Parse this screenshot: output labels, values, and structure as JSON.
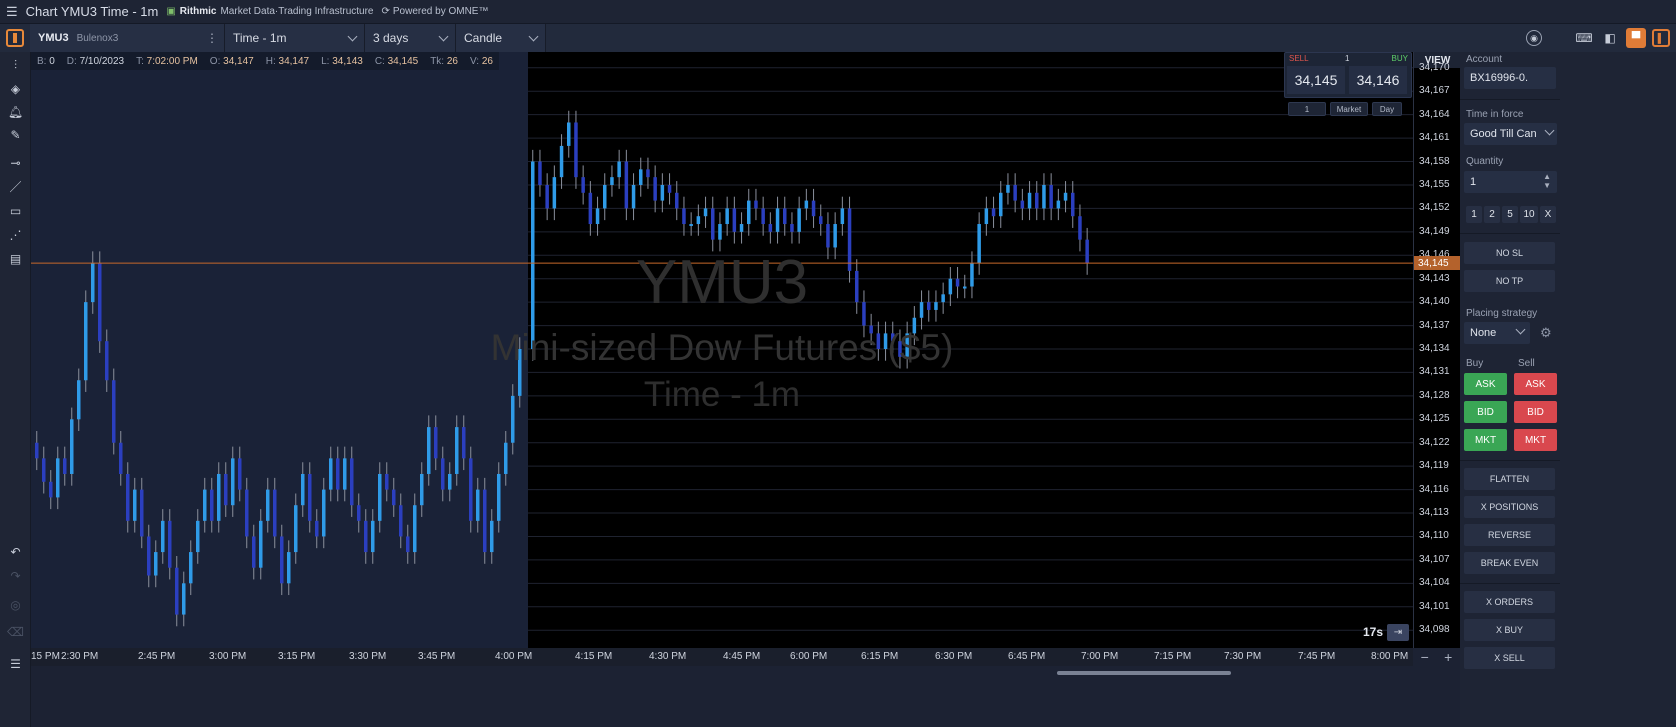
{
  "window": {
    "title": "Chart YMU3 Time - 1m",
    "brand_name": "Rithmic",
    "brand_tagline": "Market Data·Trading Infrastructure",
    "powered_by": "Powered by OMNE™"
  },
  "toolbar": {
    "symbol": "YMU3",
    "account_short": "Bulenox3",
    "interval": "Time - 1m",
    "range": "3 days",
    "chart_type": "Candle"
  },
  "ohlc": {
    "b_label": "B:",
    "b": "0",
    "d_label": "D:",
    "d": "7/10/2023",
    "t_label": "T:",
    "t": "7:02:00 PM",
    "o_label": "O:",
    "o": "34,147",
    "h_label": "H:",
    "h": "34,147",
    "l_label": "L:",
    "l": "34,143",
    "c_label": "C:",
    "c": "34,145",
    "tk_label": "Tk:",
    "tk": "26",
    "v_label": "V:",
    "v": "26"
  },
  "watermark": {
    "symbol": "YMU3",
    "name": "Mini-sized Dow Futures ($5)",
    "interval": "Time - 1m"
  },
  "chart_trader": {
    "sell_label": "SELL",
    "qty": "1",
    "buy_label": "BUY",
    "bid": "34,145",
    "ask": "34,146",
    "chip_qty": "1",
    "chip_type": "Market",
    "chip_tif": "Day"
  },
  "timer": "17s",
  "view_label": "VIEW",
  "last_price_label": "34,145",
  "colors": {
    "candle_up": "#2f9be8",
    "candle_down": "#2b3fbf",
    "last_price_line": "#c8692b",
    "buy": "#3aa655",
    "sell": "#d9484e"
  },
  "panel": {
    "account_label": "Account",
    "account_value": "BX16996-0.",
    "tif_label": "Time in force",
    "tif_value": "Good Till Can",
    "quantity_label": "Quantity",
    "quantity_value": "1",
    "quick_qty": [
      "1",
      "2",
      "5",
      "10",
      "X"
    ],
    "no_sl": "NO SL",
    "no_tp": "NO TP",
    "strategy_label": "Placing strategy",
    "strategy_value": "None",
    "buy_label": "Buy",
    "sell_label": "Sell",
    "buy_ask": "ASK",
    "sell_ask": "ASK",
    "buy_bid": "BID",
    "sell_bid": "BID",
    "buy_mkt": "MKT",
    "sell_mkt": "MKT",
    "flatten": "FLATTEN",
    "x_positions": "X POSITIONS",
    "reverse": "REVERSE",
    "break_even": "BREAK EVEN",
    "x_orders": "X ORDERS",
    "x_buy": "X BUY",
    "x_sell": "X SELL"
  },
  "chart_data": {
    "type": "candlestick",
    "y_ticks": [
      "34,170",
      "34,167",
      "34,164",
      "34,161",
      "34,158",
      "34,155",
      "34,152",
      "34,149",
      "34,146",
      "34,143",
      "34,140",
      "34,137",
      "34,134",
      "34,131",
      "34,128",
      "34,125",
      "34,122",
      "34,119",
      "34,116",
      "34,113",
      "34,110",
      "34,107",
      "34,104",
      "34,101",
      "34,098"
    ],
    "ylim": [
      34097,
      34171
    ],
    "x_ticks": [
      "2:15 PM",
      "2:30 PM",
      "2:45 PM",
      "3:00 PM",
      "3:15 PM",
      "3:30 PM",
      "3:45 PM",
      "4:00 PM",
      "4:15 PM",
      "4:30 PM",
      "4:45 PM",
      "6:00 PM",
      "6:15 PM",
      "6:30 PM",
      "6:45 PM",
      "7:00 PM",
      "7:15 PM",
      "7:30 PM",
      "7:45 PM",
      "8:00 PM"
    ],
    "x_tick_labels_shown": [
      "15 PM",
      "2:30 PM",
      "2:45 PM",
      "3:00 PM",
      "3:15 PM",
      "3:30 PM",
      "3:45 PM",
      "4:00 PM",
      "4:15 PM",
      "4:30 PM",
      "4:45 PM",
      "6:00 PM",
      "6:15 PM",
      "6:30 PM",
      "6:45 PM",
      "7:00 PM",
      "7:15 PM",
      "7:30 PM",
      "7:45 PM",
      "8:00 PM"
    ],
    "last_price": 34145,
    "closes": [
      34120,
      34117,
      34115,
      34120,
      34118,
      34125,
      34130,
      34140,
      34145,
      34135,
      34130,
      34122,
      34118,
      34112,
      34116,
      34110,
      34105,
      34108,
      34112,
      34106,
      34100,
      34104,
      34108,
      34112,
      34116,
      34112,
      34118,
      34114,
      34120,
      34116,
      34110,
      34106,
      34112,
      34116,
      34110,
      34104,
      34108,
      34114,
      34118,
      34112,
      34110,
      34116,
      34120,
      34116,
      34120,
      34114,
      34112,
      34108,
      34112,
      34118,
      34116,
      34114,
      34110,
      34108,
      34114,
      34118,
      34124,
      34120,
      34116,
      34118,
      34124,
      34120,
      34112,
      34116,
      34108,
      34112,
      34118,
      34122,
      34128,
      34134,
      34158,
      34155,
      34152,
      34156,
      34160,
      34163,
      34156,
      34154,
      34150,
      34152,
      34155,
      34156,
      34158,
      34152,
      34155,
      34157,
      34156,
      34153,
      34155,
      34154,
      34152,
      34150,
      34150,
      34151,
      34152,
      34148,
      34150,
      34152,
      34149,
      34150,
      34153,
      34152,
      34150,
      34149,
      34152,
      34150,
      34149,
      34152,
      34153,
      34151,
      34150,
      34147,
      34150,
      34152,
      34144,
      34140,
      34137,
      34136,
      34134,
      34136,
      34135,
      34133,
      34136,
      34138,
      34140,
      34139,
      34140,
      34141,
      34143,
      34142,
      34142,
      34145,
      34150,
      34152,
      34151,
      34154,
      34155,
      34153,
      34152,
      34154,
      34152,
      34155,
      34152,
      34153,
      34154,
      34151,
      34148,
      34145
    ]
  }
}
